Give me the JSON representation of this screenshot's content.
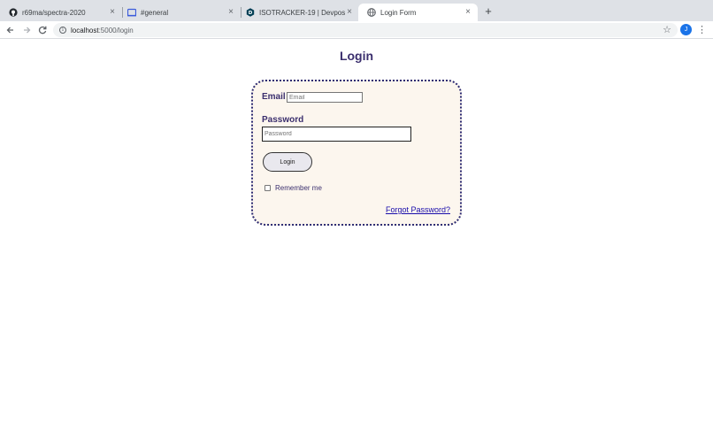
{
  "browser": {
    "tabs": [
      {
        "title": "r69ma/spectra-2020",
        "icon": "github-icon"
      },
      {
        "title": "#general",
        "icon": "slack-icon"
      },
      {
        "title": "ISOTRACKER-19 | Devpost",
        "icon": "devpost-icon"
      },
      {
        "title": "Login Form",
        "icon": "globe-icon"
      }
    ],
    "new_tab_label": "+",
    "close_label": "×",
    "url_host": "localhost",
    "url_path": ":5000/login",
    "avatar_initial": "J"
  },
  "page": {
    "title": "Login",
    "email_label": "Email",
    "email_placeholder": "Email",
    "email_value": "",
    "password_label": "Password",
    "password_placeholder": "Password",
    "password_value": "",
    "login_button": "Login",
    "remember_label": "Remember me",
    "remember_checked": false,
    "forgot_link": "Forgot Password?"
  },
  "colors": {
    "card_background": "#fcf6ee",
    "card_border": "#2c2a72",
    "heading": "#3b2f6e",
    "link": "#1a0dab"
  }
}
